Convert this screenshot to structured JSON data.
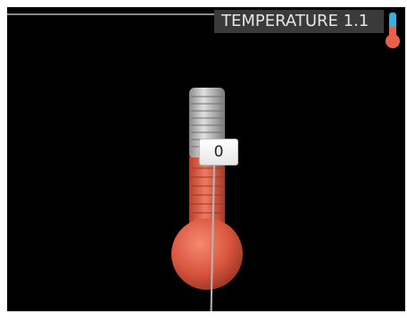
{
  "header": {
    "title": "TEMPERATURE 1.1"
  },
  "icons": {
    "menu": "thermometer-icon",
    "main": "thermometer-illustration"
  },
  "indicator": {
    "value": "0"
  },
  "colors": {
    "background": "#000000",
    "title_bar": "#3a3a3a",
    "mercury": "#e8614a",
    "tube": "#b8b8b8",
    "icon_blue": "#3aaee0"
  }
}
